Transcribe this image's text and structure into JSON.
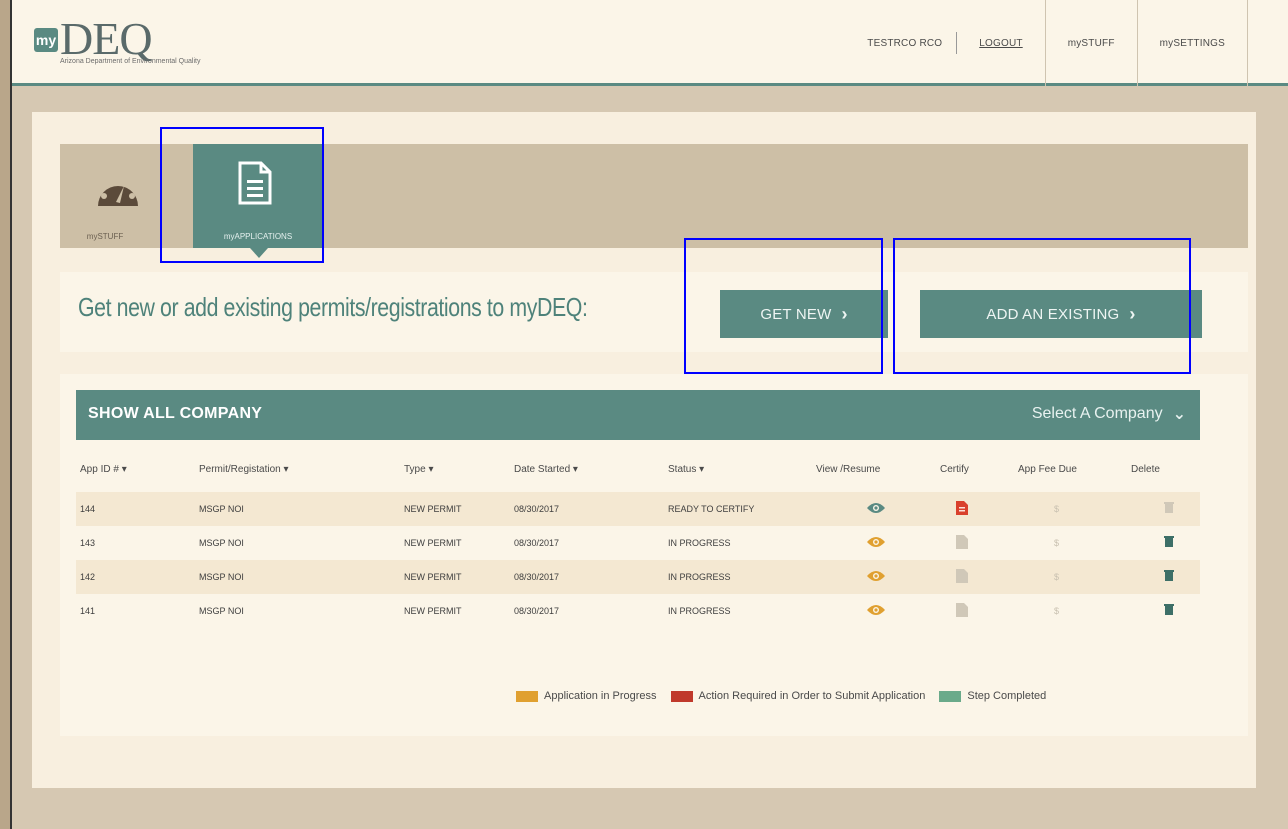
{
  "header": {
    "logo_badge": "my",
    "logo_text": "DEQ",
    "logo_sub": "Arizona Department of Environmental Quality",
    "nav": {
      "user": "TESTRCO RCO",
      "logout": "LOGOUT",
      "mystuff": "mySTUFF",
      "mysettings": "mySETTINGS"
    }
  },
  "tabs": {
    "mystuff_label": "mySTUFF",
    "myapplications_label": "myAPPLICATIONS"
  },
  "cta": {
    "text": "Get new or add existing permits/registrations to myDEQ:",
    "get_new": "GET NEW",
    "add_existing": "ADD AN EXISTING"
  },
  "table": {
    "show_all": "SHOW ALL COMPANY",
    "select_company": "Select A Company",
    "headers": {
      "app_id": "App ID # ▾",
      "permit": "Permit/Registation ▾",
      "type": "Type ▾",
      "date": "Date Started ▾",
      "status": "Status ▾",
      "view": "View /Resume",
      "certify": "Certify",
      "fee": "App Fee Due",
      "delete": "Delete"
    },
    "rows": [
      {
        "id": "144",
        "permit": "MSGP NOI",
        "type": "NEW PERMIT",
        "date": "08/30/2017",
        "status": "READY TO CERTIFY",
        "fee": "$"
      },
      {
        "id": "143",
        "permit": "MSGP NOI",
        "type": "NEW PERMIT",
        "date": "08/30/2017",
        "status": "IN PROGRESS",
        "fee": "$"
      },
      {
        "id": "142",
        "permit": "MSGP NOI",
        "type": "NEW PERMIT",
        "date": "08/30/2017",
        "status": "IN PROGRESS",
        "fee": "$"
      },
      {
        "id": "141",
        "permit": "MSGP NOI",
        "type": "NEW PERMIT",
        "date": "08/30/2017",
        "status": "IN PROGRESS",
        "fee": "$"
      }
    ]
  },
  "legend": {
    "in_progress": "Application in Progress",
    "action_required": "Action Required in Order to Submit Application",
    "completed": "Step Completed"
  },
  "colors": {
    "accent": "#5a8a82",
    "in_progress": "#e0a030",
    "action_required": "#c0392b",
    "completed": "#6aaa8a"
  }
}
